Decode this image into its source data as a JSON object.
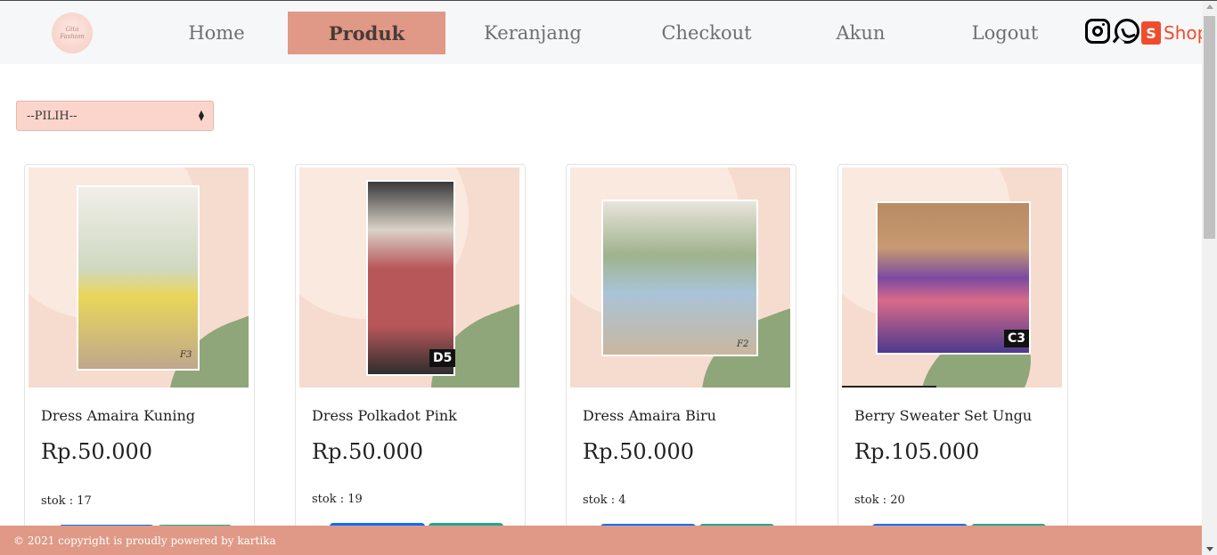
{
  "brand": {
    "logo_text": "Gita Fashion"
  },
  "nav": {
    "items": [
      {
        "label": "Home",
        "active": false
      },
      {
        "label": "Produk",
        "active": true
      },
      {
        "label": "Keranjang",
        "active": false
      },
      {
        "label": "Checkout",
        "active": false
      },
      {
        "label": "Akun",
        "active": false
      },
      {
        "label": "Logout",
        "active": false
      }
    ],
    "social": {
      "instagram_icon": "instagram-icon",
      "whatsapp_icon": "whatsapp-icon",
      "shopee_label": "Shope"
    }
  },
  "filter": {
    "selected": "--PILIH--"
  },
  "products": [
    {
      "name": "Dress Amaira Kuning",
      "price": "Rp.50.000",
      "stock": "stok : 17",
      "code": "F3",
      "photo_color": "#e9d65a"
    },
    {
      "name": "Dress Polkadot Pink",
      "price": "Rp.50.000",
      "stock": "stok : 19",
      "code": "D5",
      "photo_color": "#b8575a"
    },
    {
      "name": "Dress Amaira Biru",
      "price": "Rp.50.000",
      "stock": "stok : 4",
      "code": "F2",
      "photo_color": "#aac3d8"
    },
    {
      "name": "Berry Sweater Set Ungu",
      "price": "Rp.105.000",
      "stock": "stok : 20",
      "code": "C3",
      "photo_color": "#7a4aa0"
    }
  ],
  "footer": {
    "text": "© 2021 copyright is proudly powered by kartika"
  },
  "colors": {
    "accent": "#df9986",
    "select_bg": "#fbd5cc",
    "primary_button": "#0d6efd",
    "secondary_button": "#20a98c"
  }
}
